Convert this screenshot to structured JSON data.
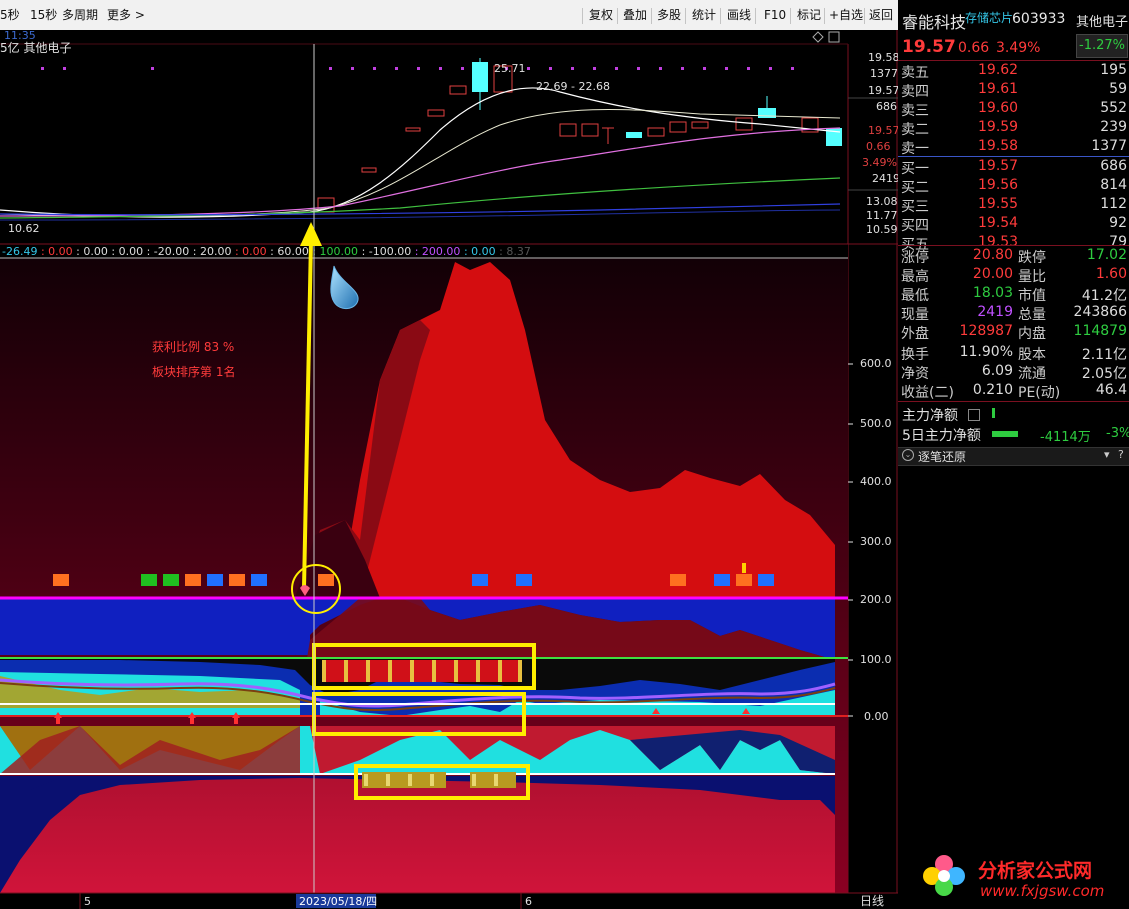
{
  "toolbar": {
    "left_items": [
      "5秒",
      "15秒",
      "多周期",
      "更多 >"
    ],
    "right_items": [
      "复权",
      "叠加",
      "多股",
      "统计",
      "画线",
      "F10",
      "标记",
      "+自选",
      "返回"
    ]
  },
  "chart_top": {
    "time_label": "11:35",
    "cap_label": "5亿 其他电子",
    "price_label_high": "25.71",
    "ma_label": "22.69 - 22.68",
    "price_label_low": "10.62",
    "axis_labels": [
      "19.58",
      "1377",
      "19.57",
      "686",
      "19.57",
      "0.66",
      "3.49%",
      "2419",
      "13.08",
      "11.77",
      "10.59"
    ],
    "indicator_line": [
      {
        "text": "-26.49",
        "color": "#35c7e8"
      },
      {
        "text": ": 0.00",
        "color": "#ff3b3b"
      },
      {
        "text": ": 0.00",
        "color": "#dddddd"
      },
      {
        "text": ": 0.00",
        "color": "#dddddd"
      },
      {
        "text": ": -20.00",
        "color": "#dddddd"
      },
      {
        "text": ": 20.00",
        "color": "#dddddd"
      },
      {
        "text": ": 0.00",
        "color": "#ff3b3b"
      },
      {
        "text": ": 60.00",
        "color": "#dddddd"
      },
      {
        "text": ": 100.00",
        "color": "#2ecc40"
      },
      {
        "text": ": -100.00",
        "color": "#dddddd"
      },
      {
        "text": ": 200.00",
        "color": "#c050ff"
      },
      {
        "text": ": 0.00",
        "color": "#35c7e8"
      },
      {
        "text": ": 8.37",
        "color": "#555555"
      }
    ]
  },
  "chart_bottom": {
    "annotation_1": "获利比例 83 %",
    "annotation_2": "板块排序第 1名",
    "axis_labels": [
      "600.0",
      "500.0",
      "400.0",
      "300.0",
      "200.0",
      "100.0",
      "0.00"
    ],
    "date_left": "5",
    "date_current": "2023/05/18/四",
    "date_right": "6",
    "period": "日线"
  },
  "stock": {
    "name": "睿能科技",
    "tag": "存储芯片",
    "code": "603933",
    "sector": "其他电子",
    "price": "19.57",
    "change": "0.66",
    "change_pct": "3.49%",
    "sector_pct": "-1.27%"
  },
  "order_book": {
    "asks": [
      {
        "label": "卖五",
        "price": "19.62",
        "vol": "195"
      },
      {
        "label": "卖四",
        "price": "19.61",
        "vol": "59"
      },
      {
        "label": "卖三",
        "price": "19.60",
        "vol": "552"
      },
      {
        "label": "卖二",
        "price": "19.59",
        "vol": "239"
      },
      {
        "label": "卖一",
        "price": "19.58",
        "vol": "1377"
      }
    ],
    "bids": [
      {
        "label": "买一",
        "price": "19.57",
        "vol": "686"
      },
      {
        "label": "买二",
        "price": "19.56",
        "vol": "814"
      },
      {
        "label": "买三",
        "price": "19.55",
        "vol": "112"
      },
      {
        "label": "买四",
        "price": "19.54",
        "vol": "92"
      },
      {
        "label": "买五",
        "price": "19.53",
        "vol": "79"
      }
    ]
  },
  "stats": [
    {
      "l1": "涨停",
      "v1": "20.80",
      "c1": "red",
      "l2": "跌停",
      "v2": "17.02",
      "c2": "green"
    },
    {
      "l1": "最高",
      "v1": "20.00",
      "c1": "red",
      "l2": "量比",
      "v2": "1.60",
      "c2": "red"
    },
    {
      "l1": "最低",
      "v1": "18.03",
      "c1": "green",
      "l2": "市值",
      "v2": "41.2亿",
      "c2": "wht"
    },
    {
      "l1": "现量",
      "v1": "2419",
      "c1": "pur",
      "l2": "总量",
      "v2": "243866",
      "c2": "wht"
    },
    {
      "l1": "外盘",
      "v1": "128987",
      "c1": "red",
      "l2": "内盘",
      "v2": "114879",
      "c2": "green"
    },
    {
      "l1": "换手",
      "v1": "11.90%",
      "c1": "wht",
      "l2": "股本",
      "v2": "2.11亿",
      "c2": "wht"
    },
    {
      "l1": "净资",
      "v1": "6.09",
      "c1": "wht",
      "l2": "流通",
      "v2": "2.05亿",
      "c2": "wht"
    },
    {
      "l1": "收益(二)",
      "v1": "0.210",
      "c1": "wht",
      "l2": "PE(动)",
      "v2": "46.4",
      "c2": "wht"
    }
  ],
  "capital": {
    "main_label": "主力净额",
    "five_day_label": "5日主力净额",
    "five_day_value": "-4114万",
    "five_day_pct": "-3%"
  },
  "panel": {
    "title": "逐笔还原",
    "help": "?"
  },
  "watermark": {
    "cn": "分析家公式网",
    "url": "www.fxjgsw.com"
  }
}
